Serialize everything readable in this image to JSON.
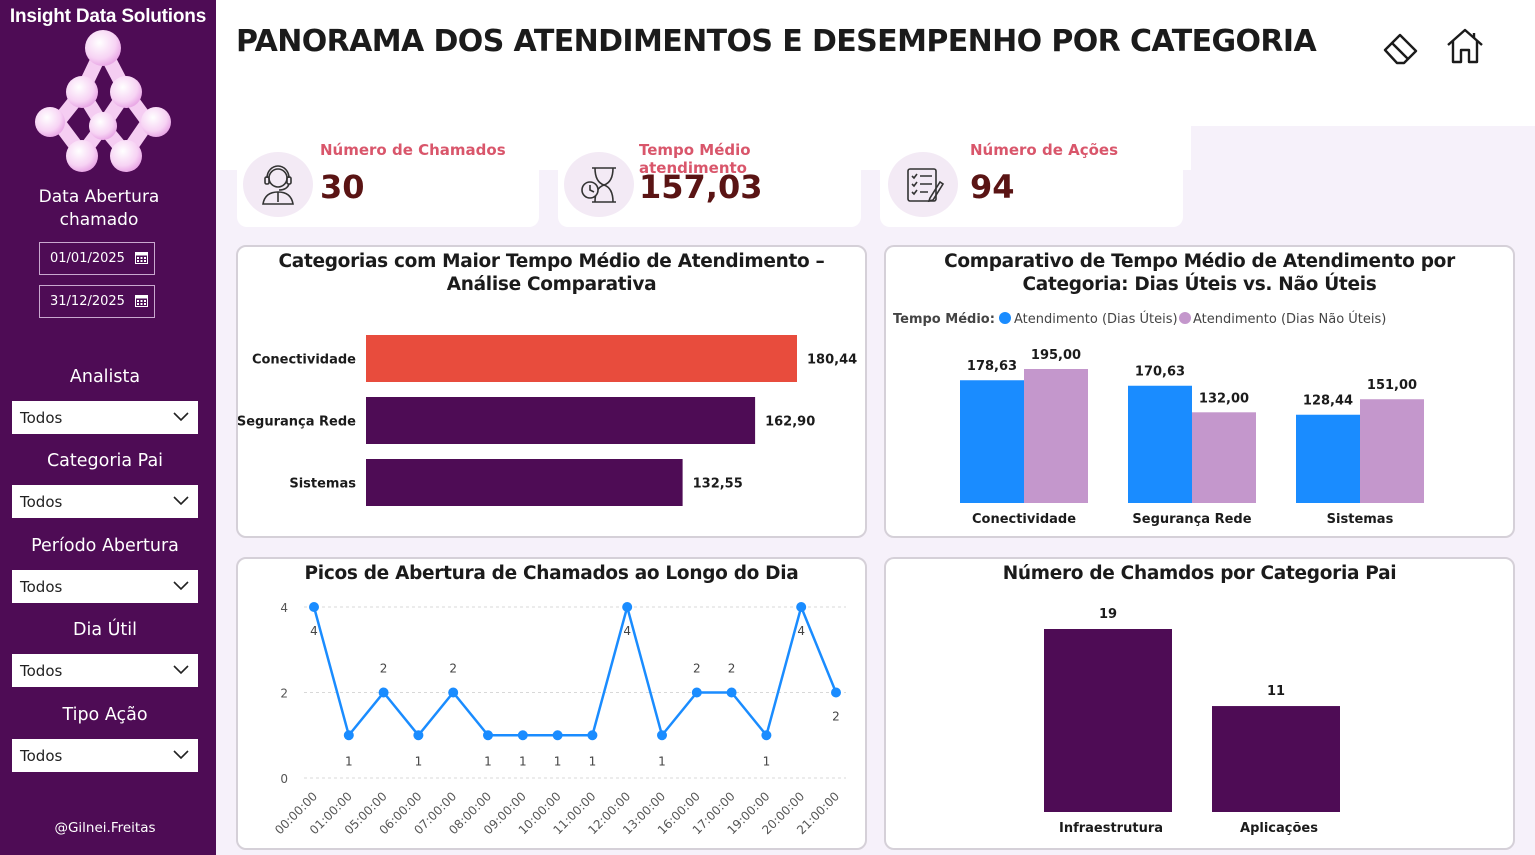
{
  "brand": "Insight Data Solutions",
  "sidebar": {
    "date_title": "Data Abertura chamado",
    "date_start": "01/01/2025",
    "date_end": "31/12/2025",
    "filters": [
      {
        "label": "Analista",
        "value": "Todos"
      },
      {
        "label": "Categoria Pai",
        "value": "Todos"
      },
      {
        "label": "Período Abertura",
        "value": "Todos"
      },
      {
        "label": "Dia Útil",
        "value": "Todos"
      },
      {
        "label": "Tipo Ação",
        "value": "Todos"
      }
    ],
    "footer": "@Gilnei.Freitas"
  },
  "header": {
    "title": "PANORAMA DOS ATENDIMENTOS E DESEMPENHO POR CATEGORIA",
    "icons": [
      "eraser-icon",
      "home-icon"
    ]
  },
  "kpis": [
    {
      "label": "Número de Chamados",
      "value": "30",
      "icon": "headset-agent-icon"
    },
    {
      "label": "Tempo Médio atendimento",
      "value": "157,03",
      "icon": "hourglass-clock-icon"
    },
    {
      "label": "Número de Ações",
      "value": "94",
      "icon": "checklist-icon"
    }
  ],
  "colors": {
    "sidebar": "#4e0c55",
    "bar_highlight": "#e84c3d",
    "bar_primary": "#4e0c55",
    "series_blue": "#1a8cff",
    "series_lilac": "#c497cc",
    "kpi_label": "#d9566b",
    "kpi_value": "#5a1414"
  },
  "chart_data": [
    {
      "type": "bar",
      "orientation": "horizontal",
      "title": "Categorias com Maior Tempo Médio de Atendimento – Análise Comparativa",
      "categories": [
        "Conectividade",
        "Segurança Rede",
        "Sistemas"
      ],
      "values": [
        180.44,
        162.9,
        132.55
      ],
      "labels": [
        "180,44",
        "162,90",
        "132,55"
      ]
    },
    {
      "type": "bar",
      "title": "Comparativo de Tempo Médio de Atendimento por Categoria: Dias Úteis vs. Não Úteis",
      "legend_title": "Tempo Médio:",
      "legend_position": "top-left",
      "categories": [
        "Conectividade",
        "Segurança Rede",
        "Sistemas"
      ],
      "series": [
        {
          "name": "Atendimento (Dias Úteis)",
          "values": [
            178.63,
            170.63,
            128.44
          ],
          "labels": [
            "178,63",
            "170,63",
            "128,44"
          ]
        },
        {
          "name": "Atendimento (Dias Não Úteis)",
          "values": [
            195.0,
            132.0,
            151.0
          ],
          "labels": [
            "195,00",
            "132,00",
            "151,00"
          ]
        }
      ]
    },
    {
      "type": "line",
      "title": "Picos de Abertura de Chamados ao Longo do Dia",
      "x": [
        "00:00:00",
        "01:00:00",
        "05:00:00",
        "06:00:00",
        "07:00:00",
        "08:00:00",
        "09:00:00",
        "10:00:00",
        "11:00:00",
        "12:00:00",
        "13:00:00",
        "16:00:00",
        "17:00:00",
        "19:00:00",
        "20:00:00",
        "21:00:00"
      ],
      "y": [
        4,
        1,
        2,
        1,
        2,
        1,
        1,
        1,
        1,
        4,
        1,
        2,
        2,
        1,
        4,
        2
      ],
      "y_ticks": [
        "0",
        "2",
        "4"
      ],
      "ylim": [
        0,
        4
      ],
      "grid": true
    },
    {
      "type": "bar",
      "title": "Número de Chamdos por Categoria Pai",
      "categories": [
        "Infraestrutura",
        "Aplicações"
      ],
      "values": [
        19,
        11
      ]
    }
  ]
}
